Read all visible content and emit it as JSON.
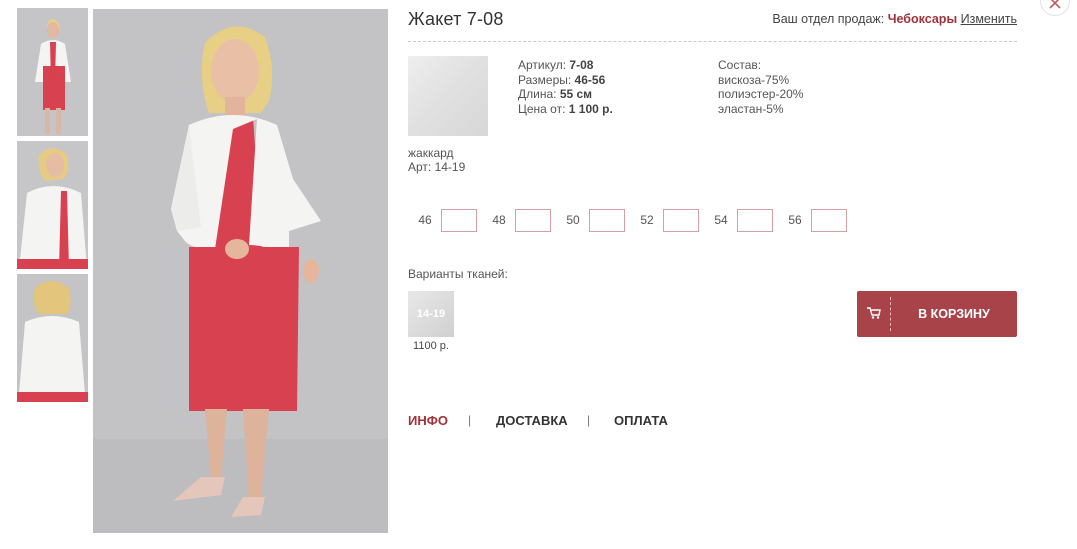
{
  "product": {
    "title": "Жакет 7-08"
  },
  "sales": {
    "label": "Ваш отдел продаж:",
    "city": "Чебоксары",
    "change": "Изменить"
  },
  "fabric": {
    "name": "жаккард",
    "art": "Арт: 14-19"
  },
  "specs": {
    "article_label": "Артикул:",
    "article_value": "7-08",
    "sizes_label": "Размеры:",
    "sizes_value": "46-56",
    "length_label": "Длина:",
    "length_value": "55 см",
    "price_label": "Цена от:",
    "price_value": "1 100 р."
  },
  "composition": {
    "title": "Состав:",
    "items": [
      "вискоза-75%",
      "полиэстер-20%",
      "эластан-5%"
    ]
  },
  "sizes": [
    "46",
    "48",
    "50",
    "52",
    "54",
    "56"
  ],
  "variants": {
    "label": "Варианты тканей:",
    "items": [
      {
        "code": "14-19",
        "price": "1100 р."
      }
    ]
  },
  "cart": {
    "label": "В КОРЗИНУ"
  },
  "tabs": [
    {
      "label": "ИНФО",
      "active": true
    },
    {
      "label": "ДОСТАВКА",
      "active": false
    },
    {
      "label": "ОПЛАТА",
      "active": false
    }
  ],
  "colors": {
    "accent": "#a8434a",
    "brand_text": "#a0323a",
    "photo_bg": "#c3c3c6",
    "dress_red": "#d84150",
    "jacket_white": "#f4f4f2"
  },
  "icons": {
    "close": "close-icon",
    "cart": "cart-icon"
  }
}
